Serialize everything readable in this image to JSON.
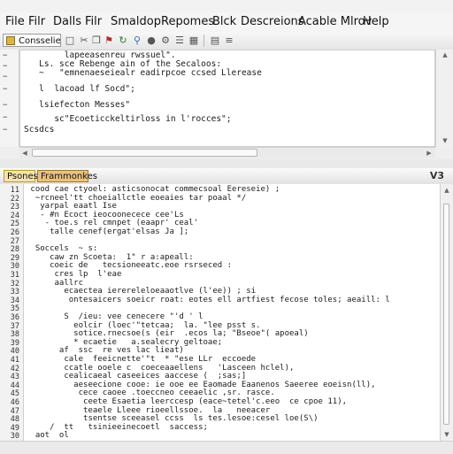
{
  "menu": [
    "File",
    "Filr",
    "Dalls",
    "Filr",
    "Smaldop",
    "Repomes",
    "Blck",
    "Descreions",
    "Acable Mlrov",
    "Help"
  ],
  "toolbar": {
    "combo_label": "Consselient",
    "icons": [
      "document-icon",
      "cut-icon",
      "copy-icon",
      "paste-icon",
      "flag-icon",
      "refresh-icon",
      "search-icon",
      "bookmark-icon",
      "settings-icon",
      "list-icon",
      "grid-icon",
      "separator",
      "table-icon",
      "align-icon"
    ]
  },
  "upper_editor": {
    "lines": [
      "        lapeeasenreu rwssuel\".",
      "   Ls. sce Rebenge ain of the Secaloos:",
      "   ~   \"emnenaeseiealr eadirpcoe ccsed Llerease",
      "",
      "   l  lacoad lf Socd\";",
      "",
      "   lsiefecton Messes\"",
      "",
      "      sc\"Ecoeticckeltirloss in l'rocces\";",
      "Scsdcs"
    ]
  },
  "lower_pane": {
    "tabs": [
      "Psones",
      "Frammonkes"
    ],
    "corner_label": "V3",
    "line_numbers": [
      "11",
      "22",
      "23",
      "24",
      "25",
      "26",
      "27",
      "28",
      "29",
      "30",
      "31",
      "32",
      "33",
      "34",
      "35",
      "36",
      "37",
      "38",
      "39",
      "40",
      "41",
      "42",
      "43",
      "44",
      "45",
      "46",
      "47",
      "48",
      "49",
      "30"
    ],
    "code_lines": [
      " cood cae ctyoel: asticsonocat commecsoal Eereseie) ;",
      "  ~rcneel'tt choeiallctle eoeaies tar poaal */",
      "   yarpal eaatl Ise",
      "   - #n Ecoct ieocoonecece cee'Ls",
      "    - toe.s rel cmnpet (eaapr' ceal'",
      "     talle cenef(ergat'elsas Ja ];",
      "",
      "  Soccels  ~ s:",
      "     caw zn Scoeta:  1\" r a:apeall:",
      "     coeic de   tecsioneeatc.eoe rsrseced :",
      "      cres lp  l'eae",
      "      aallrc",
      "        ecaectea ierereleloeaaotlve (l'ee)) ; si",
      "         ontesaicers soeicr roat: eotes ell artfiest fecose toles; aeaill: l",
      "",
      "        S  /ieu: vee cenecere \"'d ' l",
      "          eolcir (loec'\"tetcaa;  la. \"lee psst s.",
      "          sotice.rnecsoe(s (eir  .ecos la; \"Bseoe\"( apoeal)",
      "          * ecaetie   a.sealecry geltoae;",
      "       af  ssc  re ves lac lieat)",
      "        cale  feeicnette'\"t  * \"ese LLr  eccoede",
      "        ccatle ooele c  coeceaaellens   'Lasceen hclel),",
      "        cealicaeal caseeices aaccese (  ;sas;]",
      "          aeseecione cooe: ie ooe ee Eaomade Eaanenos Saeeree eoeisn(ll),",
      "           cece caoee .toeccneo ceeaelic ,sr. rasce.",
      "            ceete Esaetia leerccesp (eace~tetel'c.eeo  ce cpoe 11),",
      "            teaele Lleee rioeellssoe.  la   neeacer",
      "            tsentse sceeasel ccss  ls tes.lesoe:cesel loe(S\\)",
      "     /  tt   tsinieeinecoetl  saccess;",
      "  aot  ol"
    ]
  },
  "colors": {
    "menu_bg": "#f5f5f5",
    "editor_bg": "#ffffff",
    "gutter_bg": "#f2f2f2",
    "active_tab": "#f4e4a6",
    "second_tab": "#e8c27d"
  }
}
